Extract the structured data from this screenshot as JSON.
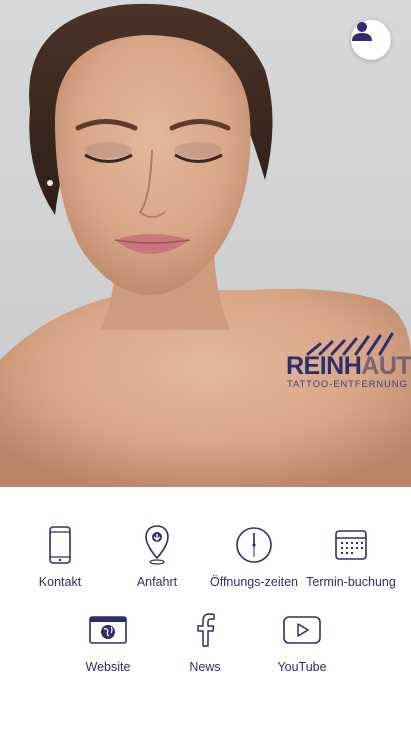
{
  "theme": {
    "accent": "#2b2f6b",
    "background": "#ffffff"
  },
  "hero": {
    "logo_word_main": "REINH",
    "logo_word_faded": "AUT",
    "logo_sub": "TATTOO-ENTFERNUNG",
    "profile_icon": "user-icon"
  },
  "menu": {
    "row1": [
      {
        "label": "Kontakt",
        "icon": "phone-icon"
      },
      {
        "label": "Anfahrt",
        "icon": "map-pin-icon"
      },
      {
        "label": "Öffnungs-zeiten",
        "icon": "clock-icon"
      },
      {
        "label": "Termin-buchung",
        "icon": "calendar-icon"
      }
    ],
    "row2": [
      {
        "label": "Website",
        "icon": "globe-window-icon"
      },
      {
        "label": "News",
        "icon": "facebook-icon"
      },
      {
        "label": "YouTube",
        "icon": "youtube-play-icon"
      }
    ]
  }
}
